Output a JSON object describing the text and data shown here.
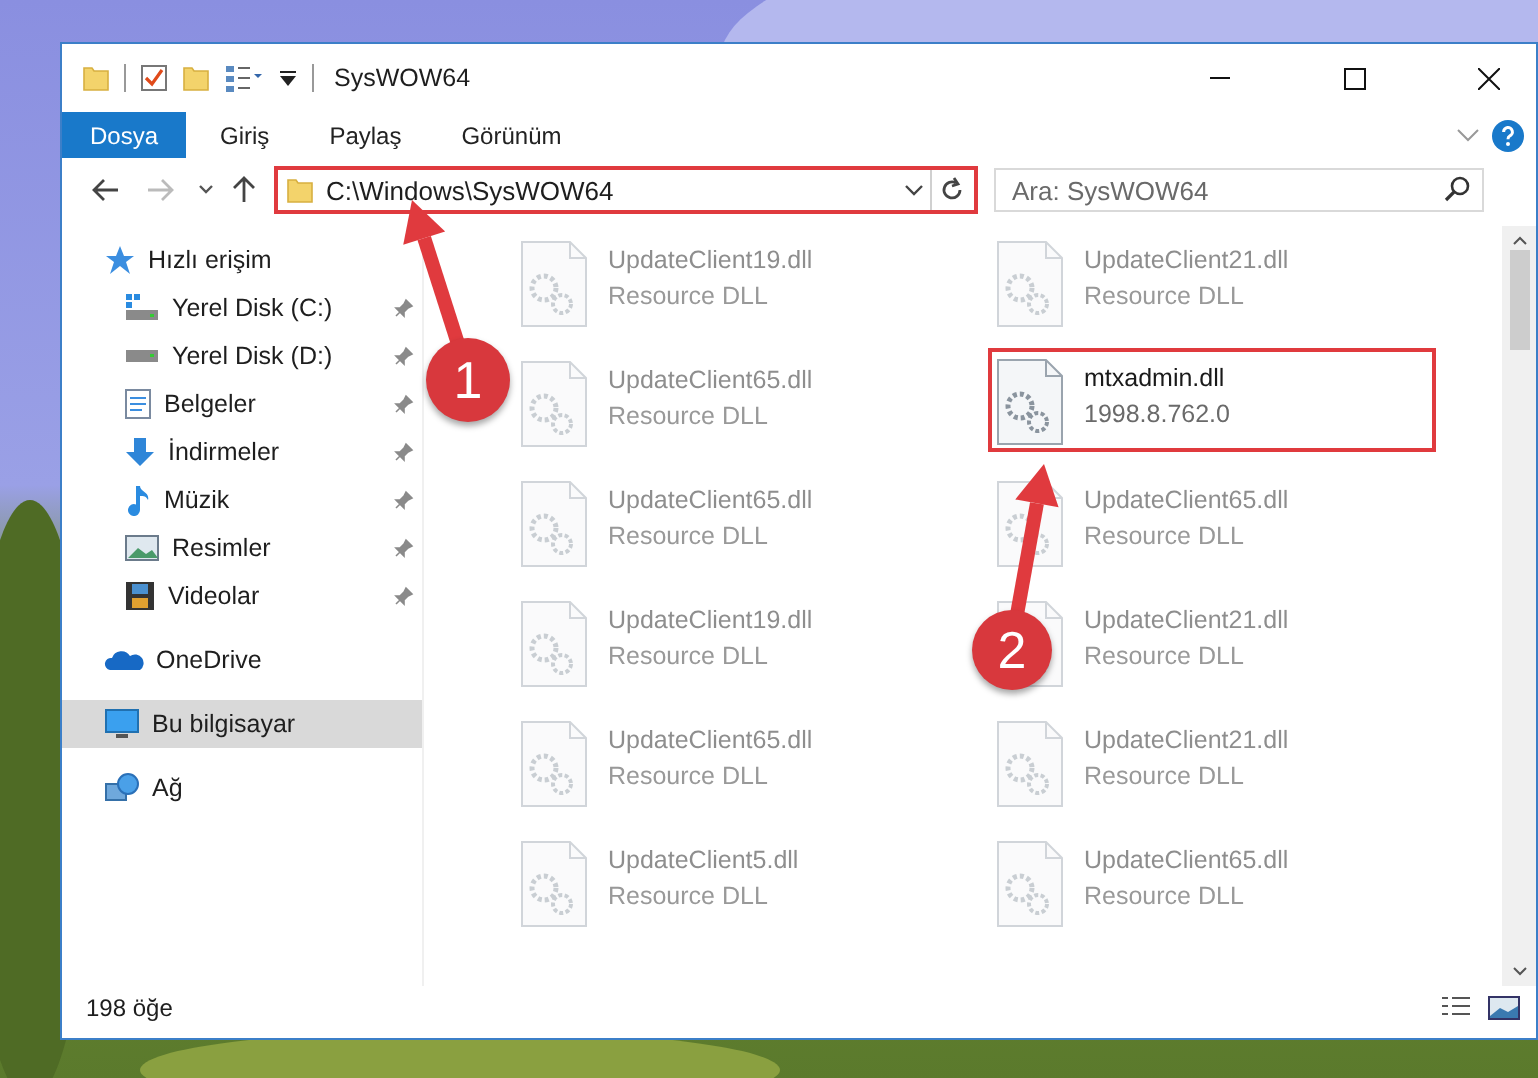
{
  "window": {
    "title": "SysWOW64"
  },
  "ribbon_tabs": [
    {
      "label": "Dosya",
      "selected": true
    },
    {
      "label": "Giriş",
      "selected": false
    },
    {
      "label": "Paylaş",
      "selected": false
    },
    {
      "label": "Görünüm",
      "selected": false
    }
  ],
  "address": {
    "path": "C:\\Windows\\SysWOW64",
    "highlighted": true
  },
  "search": {
    "placeholder": "Ara: SysWOW64"
  },
  "sidebar": {
    "items": [
      {
        "label": "Hızlı erişim",
        "kind": "star",
        "selected": false,
        "children": [
          {
            "label": "Yerel Disk (C:)",
            "kind": "drive-win",
            "pinned": true,
            "selected": false
          },
          {
            "label": "Yerel Disk (D:)",
            "kind": "drive",
            "pinned": true,
            "selected": false
          },
          {
            "label": "Belgeler",
            "kind": "docs",
            "pinned": true,
            "selected": false
          },
          {
            "label": "İndirmeler",
            "kind": "download",
            "pinned": true,
            "selected": false
          },
          {
            "label": "Müzik",
            "kind": "music",
            "pinned": true,
            "selected": false
          },
          {
            "label": "Resimler",
            "kind": "pictures",
            "pinned": true,
            "selected": false
          },
          {
            "label": "Videolar",
            "kind": "videos",
            "pinned": true,
            "selected": false
          }
        ]
      },
      {
        "label": "OneDrive",
        "kind": "cloud",
        "selected": false
      },
      {
        "label": "Bu bilgisayar",
        "kind": "computer",
        "selected": true
      },
      {
        "label": "Ağ",
        "kind": "network",
        "selected": false
      }
    ]
  },
  "files": [
    {
      "name": "UpdateClient19.dll",
      "detail": "Resource DLL",
      "blurred": true,
      "highlighted": false
    },
    {
      "name": "UpdateClient21.dll",
      "detail": "Resource DLL",
      "blurred": true,
      "highlighted": false
    },
    {
      "name": "UpdateClient65.dll",
      "detail": "Resource DLL",
      "blurred": true,
      "highlighted": false
    },
    {
      "name": "mtxadmin.dll",
      "detail": "1998.8.762.0",
      "blurred": false,
      "highlighted": true
    },
    {
      "name": "UpdateClient65.dll",
      "detail": "Resource DLL",
      "blurred": true,
      "highlighted": false
    },
    {
      "name": "UpdateClient65.dll",
      "detail": "Resource DLL",
      "blurred": true,
      "highlighted": false
    },
    {
      "name": "UpdateClient19.dll",
      "detail": "Resource DLL",
      "blurred": true,
      "highlighted": false
    },
    {
      "name": "UpdateClient21.dll",
      "detail": "Resource DLL",
      "blurred": true,
      "highlighted": false
    },
    {
      "name": "UpdateClient65.dll",
      "detail": "Resource DLL",
      "blurred": true,
      "highlighted": false
    },
    {
      "name": "UpdateClient21.dll",
      "detail": "Resource DLL",
      "blurred": true,
      "highlighted": false
    },
    {
      "name": "UpdateClient5.dll",
      "detail": "Resource DLL",
      "blurred": true,
      "highlighted": false
    },
    {
      "name": "UpdateClient65.dll",
      "detail": "Resource DLL",
      "blurred": true,
      "highlighted": false
    }
  ],
  "status_bar": {
    "count": "198 öğe"
  },
  "annotations": [
    {
      "label": "1"
    },
    {
      "label": "2"
    }
  ]
}
